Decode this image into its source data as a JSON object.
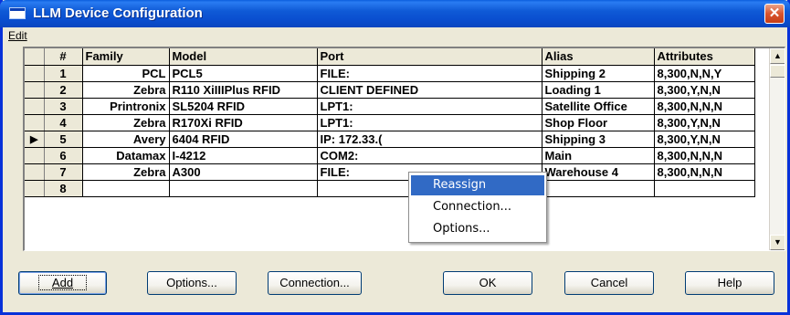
{
  "window": {
    "title": "LLM Device Configuration",
    "close_glyph": "✕"
  },
  "menu": {
    "edit": "Edit"
  },
  "grid": {
    "headers": {
      "num": "#",
      "family": "Family",
      "model": "Model",
      "port": "Port",
      "alias": "Alias",
      "attributes": "Attributes"
    },
    "rows": [
      {
        "num": "1",
        "family": "PCL",
        "model": "PCL5",
        "port": "FILE:",
        "alias": "Shipping 2",
        "attributes": "8,300,N,N,Y",
        "selected": false
      },
      {
        "num": "2",
        "family": "Zebra",
        "model": "R110 XiIIIPlus RFID",
        "port": "CLIENT DEFINED",
        "alias": "Loading 1",
        "attributes": "8,300,Y,N,N",
        "selected": false
      },
      {
        "num": "3",
        "family": "Printronix",
        "model": "SL5204 RFID",
        "port": "LPT1:",
        "alias": "Satellite Office",
        "attributes": "8,300,N,N,N",
        "selected": false
      },
      {
        "num": "4",
        "family": "Zebra",
        "model": "R170Xi RFID",
        "port": "LPT1:",
        "alias": "Shop Floor",
        "attributes": "8,300,Y,N,N",
        "selected": false
      },
      {
        "num": "5",
        "family": "Avery",
        "model": "6404 RFID",
        "port": "IP: 172.33.(",
        "alias": "Shipping 3",
        "attributes": "8,300,Y,N,N",
        "selected": true
      },
      {
        "num": "6",
        "family": "Datamax",
        "model": "I-4212",
        "port": "COM2:",
        "alias": "Main",
        "attributes": "8,300,N,N,N",
        "selected": false
      },
      {
        "num": "7",
        "family": "Zebra",
        "model": "A300",
        "port": "FILE:",
        "alias": "Warehouse 4",
        "attributes": "8,300,N,N,N",
        "selected": false
      },
      {
        "num": "8",
        "family": "",
        "model": "",
        "port": "",
        "alias": "",
        "attributes": "",
        "selected": false
      }
    ],
    "row_indicator_icon": "row-pointer-icon"
  },
  "context_menu": {
    "items": [
      {
        "label": "Reassign",
        "active": true
      },
      {
        "label": "Connection...",
        "active": false
      },
      {
        "label": "Options...",
        "active": false
      }
    ]
  },
  "buttons": {
    "add": "Add",
    "options": "Options...",
    "connection": "Connection...",
    "ok": "OK",
    "cancel": "Cancel",
    "help": "Help"
  },
  "colors": {
    "title_bar": "#0a4fd0",
    "menu_highlight": "#316ac5",
    "dialog_bg": "#ece9d8"
  }
}
